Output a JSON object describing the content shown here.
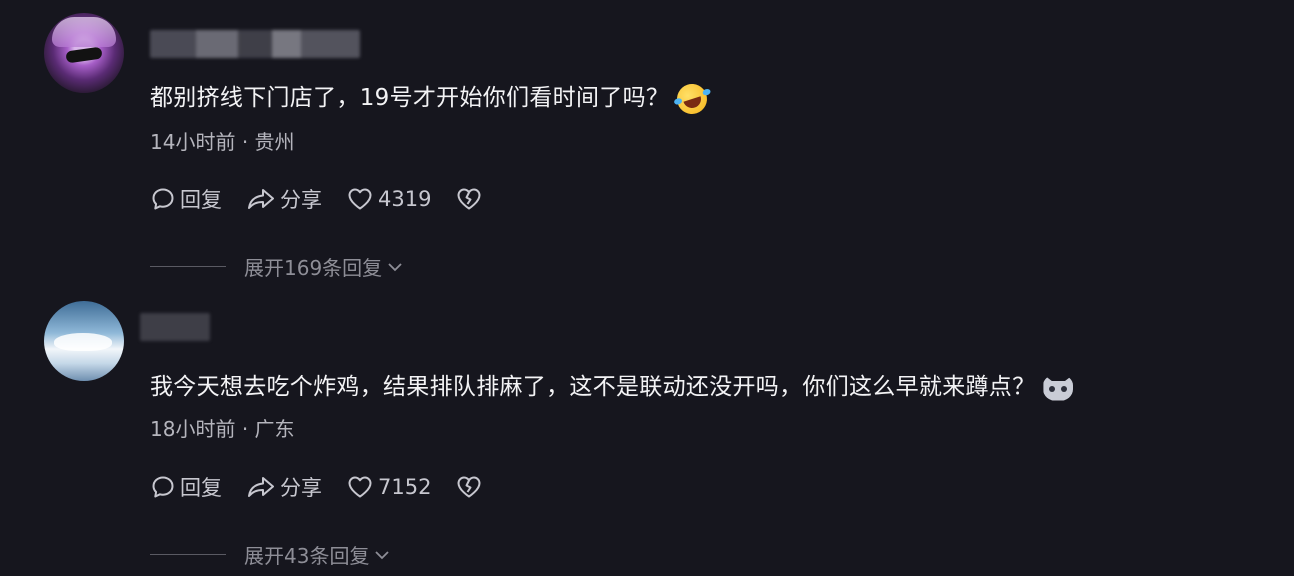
{
  "comments": [
    {
      "text": "都别挤线下门店了，19号才开始你们看时间了吗？",
      "emoji": "rolling-laughing-emoji",
      "time": "14小时前",
      "separator": "·",
      "location": "贵州",
      "reply_label": "回复",
      "share_label": "分享",
      "likes": "4319",
      "expand_label": "展开169条回复"
    },
    {
      "text": "我今天想去吃个炸鸡，结果排队排麻了，这不是联动还没开吗，你们这么早就来蹲点？",
      "emoji": "cat-face-emoji",
      "time": "18小时前",
      "separator": "·",
      "location": "广东",
      "reply_label": "回复",
      "share_label": "分享",
      "likes": "7152",
      "expand_label": "展开43条回复"
    }
  ],
  "icons": {
    "reply": "speech-bubble-icon",
    "share": "share-arrow-icon",
    "like": "heart-icon",
    "dislike": "broken-heart-icon",
    "expand": "chevron-down-icon"
  },
  "colors": {
    "background": "#16161e",
    "text_primary": "#f3f3f5",
    "text_secondary": "#b5b5bd",
    "text_muted": "#8e8e97"
  }
}
